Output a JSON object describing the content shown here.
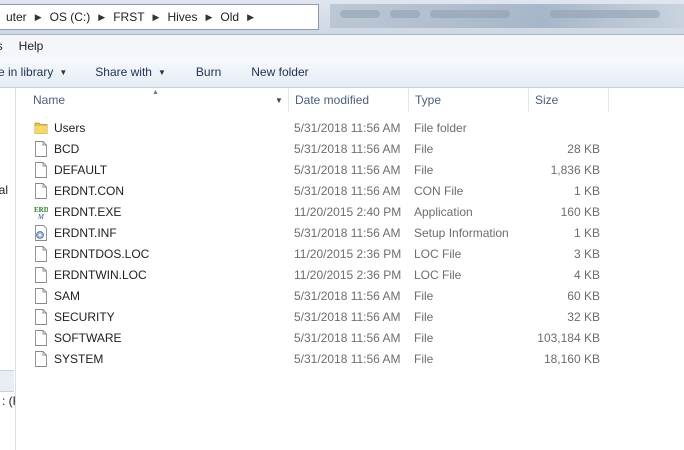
{
  "address": {
    "crumbs": [
      "uter",
      "OS (C:)",
      "FRST",
      "Hives",
      "Old"
    ]
  },
  "menubar": {
    "help": "Help",
    "left_fragment": "ls"
  },
  "commandbar": {
    "include_in_library": "e in library",
    "share_with": "Share with",
    "burn": "Burn",
    "new_folder": "New folder"
  },
  "navpane": {
    "frag1": "cial",
    "frag2": ": (F"
  },
  "columns": {
    "name": "Name",
    "date": "Date modified",
    "type": "Type",
    "size": "Size"
  },
  "files": [
    {
      "name": "Users",
      "date": "5/31/2018 11:56 AM",
      "type": "File folder",
      "size": "",
      "icon": "folder-icon"
    },
    {
      "name": "BCD",
      "date": "5/31/2018 11:56 AM",
      "type": "File",
      "size": "28 KB",
      "icon": "file-icon"
    },
    {
      "name": "DEFAULT",
      "date": "5/31/2018 11:56 AM",
      "type": "File",
      "size": "1,836 KB",
      "icon": "file-icon"
    },
    {
      "name": "ERDNT.CON",
      "date": "5/31/2018 11:56 AM",
      "type": "CON File",
      "size": "1 KB",
      "icon": "file-icon"
    },
    {
      "name": "ERDNT.EXE",
      "date": "11/20/2015 2:40 PM",
      "type": "Application",
      "size": "160 KB",
      "icon": "application-icon"
    },
    {
      "name": "ERDNT.INF",
      "date": "5/31/2018 11:56 AM",
      "type": "Setup Information",
      "size": "1 KB",
      "icon": "setup-info-icon"
    },
    {
      "name": "ERDNTDOS.LOC",
      "date": "11/20/2015 2:36 PM",
      "type": "LOC File",
      "size": "3 KB",
      "icon": "file-icon"
    },
    {
      "name": "ERDNTWIN.LOC",
      "date": "11/20/2015 2:36 PM",
      "type": "LOC File",
      "size": "4 KB",
      "icon": "file-icon"
    },
    {
      "name": "SAM",
      "date": "5/31/2018 11:56 AM",
      "type": "File",
      "size": "60 KB",
      "icon": "file-icon"
    },
    {
      "name": "SECURITY",
      "date": "5/31/2018 11:56 AM",
      "type": "File",
      "size": "32 KB",
      "icon": "file-icon"
    },
    {
      "name": "SOFTWARE",
      "date": "5/31/2018 11:56 AM",
      "type": "File",
      "size": "103,184 KB",
      "icon": "file-icon"
    },
    {
      "name": "SYSTEM",
      "date": "5/31/2018 11:56 AM",
      "type": "File",
      "size": "18,160 KB",
      "icon": "file-icon"
    }
  ]
}
